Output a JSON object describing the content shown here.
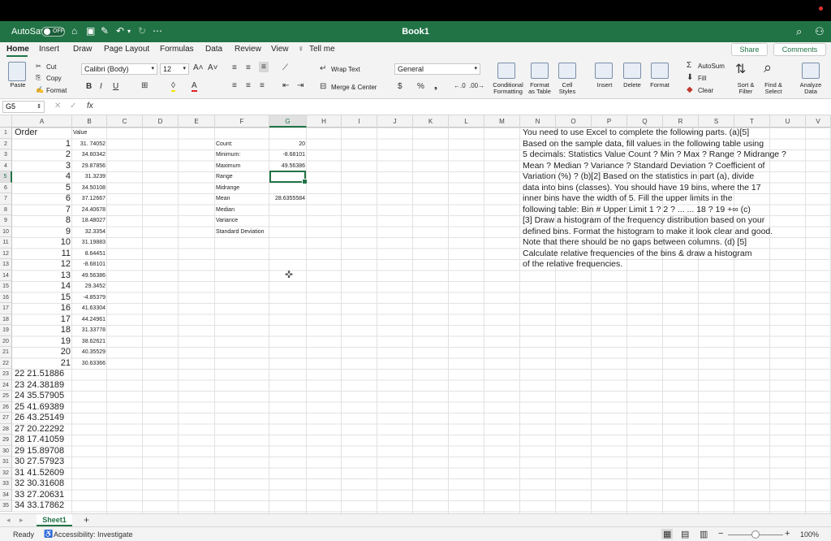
{
  "titlebar": {
    "autosave_label": "AutoSave",
    "autosave_state": "OFF",
    "title": "Book1"
  },
  "menu": {
    "tabs": [
      "Home",
      "Insert",
      "Draw",
      "Page Layout",
      "Formulas",
      "Data",
      "Review",
      "View"
    ],
    "tellme": "Tell me",
    "share": "Share",
    "comments": "Comments"
  },
  "ribbon": {
    "paste": "Paste",
    "cut": "Cut",
    "copy": "Copy",
    "format": "Format",
    "font_name": "Calibri (Body)",
    "font_size": "12",
    "wrap_text": "Wrap Text",
    "merge_center": "Merge & Center",
    "number_format": "General",
    "conditional_formatting": "Conditional\nFormatting",
    "format_as_table": "Format\nas Table",
    "cell_styles": "Cell\nStyles",
    "insert": "Insert",
    "delete": "Delete",
    "format_cells": "Format",
    "autosum": "AutoSum",
    "fill": "Fill",
    "clear": "Clear",
    "sort_filter": "Sort &\nFilter",
    "find_select": "Find &\nSelect",
    "analyze_data": "Analyze\nData"
  },
  "formula_bar": {
    "name_box": "G5",
    "fx": "fx",
    "value": ""
  },
  "columns": [
    "A",
    "B",
    "C",
    "D",
    "E",
    "F",
    "G",
    "H",
    "I",
    "J",
    "K",
    "L",
    "M",
    "N",
    "O",
    "P",
    "Q",
    "R",
    "S",
    "T",
    "U",
    "V"
  ],
  "rows": [
    "1",
    "2",
    "3",
    "4",
    "5",
    "6",
    "7",
    "8",
    "9",
    "10",
    "11",
    "12",
    "13",
    "14",
    "15",
    "16",
    "17",
    "18",
    "19",
    "20",
    "21",
    "22",
    "23",
    "24",
    "25",
    "26",
    "27",
    "28",
    "29",
    "30",
    "31",
    "32",
    "33",
    "34",
    "35"
  ],
  "cells": {
    "a1": "Order",
    "b1": "Value",
    "order": [
      "1",
      "2",
      "3",
      "4",
      "5",
      "6",
      "7",
      "8",
      "9",
      "10",
      "11",
      "12",
      "13",
      "14",
      "15",
      "16",
      "17",
      "18",
      "19",
      "20",
      "21"
    ],
    "values": [
      "31. 74052",
      "34.60342",
      "29.87856",
      "31.3239",
      "34.50108",
      "37.12667",
      "24.40678",
      "18.48027",
      "32.3354",
      "31.19883",
      "8.64451",
      "-8.68101",
      "49.56386",
      "29.3452",
      "-4.85379",
      "41.63304",
      "44.24961",
      "31.33778",
      "38.62621",
      "40.35529",
      "30.63366"
    ],
    "merged_rows": [
      "22 21.51886",
      "23 24.38189",
      "24 35.57905",
      "25 41.69389",
      "26 43.25149",
      "27 20.22292",
      "28 17.41059",
      "29 15.89708",
      "30 27.57923",
      "31 41.52609",
      "32 30.31608",
      "33 27.20631",
      "34 33.17862"
    ],
    "stats_labels": [
      "Count:",
      "Minimum:",
      "Maximum",
      "Range",
      "Midrange",
      "Mean",
      "Median",
      "Variance",
      "Standard Deviation"
    ],
    "stats_values": [
      "20",
      "-8.68101",
      "49.56386",
      "",
      "",
      "28.6355584",
      "",
      "",
      ""
    ]
  },
  "instructions": [
    "You need to use Excel to complete the following parts. (a)[5]",
    "Based on the sample data, fill values in the following table using",
    "5 decimals: Statistics Value Count ? Min ? Max ? Range ? Midrange ?",
    "Mean ? Median ? Variance ? Standard Deviation ? Coefficient of",
    "Variation (%) ? (b)[2] Based on the statistics in part (a), divide",
    "data into bins (classes). You should have 19 bins, where the 17",
    "inner bins have the width of 5. Fill the upper limits in the",
    "following table: Bin # Upper Limit 1 ? 2 ? ... ... 18 ? 19 +∞ (c)",
    "[3] Draw a histogram of the frequency distribution based on your",
    "defined bins. Format the histogram to make it look clear and good.",
    "Note that there should be no gaps between columns. (d) [5]",
    "Calculate relative frequencies of the bins & draw a histogram",
    "of the relative frequencies."
  ],
  "sheet_tab": "Sheet1",
  "status": {
    "ready": "Ready",
    "accessibility": "Accessibility: Investigate",
    "zoom": "100%"
  }
}
